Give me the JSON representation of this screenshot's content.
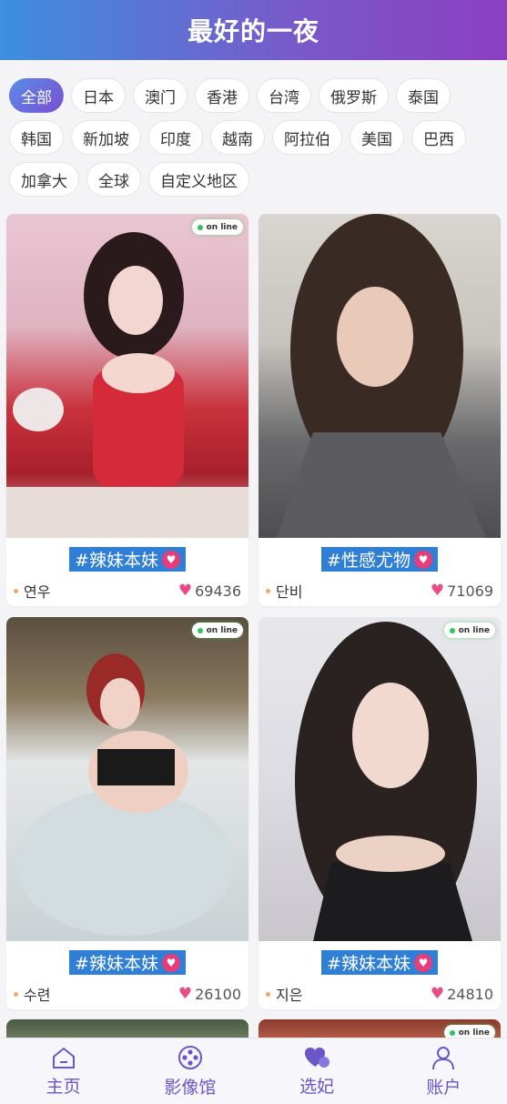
{
  "header": {
    "title": "最好的一夜"
  },
  "regions": {
    "items": [
      "全部",
      "日本",
      "澳门",
      "香港",
      "台湾",
      "俄罗斯",
      "泰国",
      "韩国",
      "新加坡",
      "印度",
      "越南",
      "阿拉伯",
      "美国",
      "巴西",
      "加拿大",
      "全球",
      "自定义地区"
    ],
    "active": "全部"
  },
  "online_label": "on line",
  "cards": [
    {
      "tag": "#辣妹本妹",
      "name": "연우",
      "likes": "69436"
    },
    {
      "tag": "#性感尤物",
      "name": "단비",
      "likes": "71069"
    },
    {
      "tag": "#辣妹本妹",
      "name": "수련",
      "likes": "26100"
    },
    {
      "tag": "#辣妹本妹",
      "name": "지은",
      "likes": "24810"
    }
  ],
  "tabbar": {
    "home": "主页",
    "cinema": "影像馆",
    "select": "选妃",
    "account": "账户"
  },
  "colors": {
    "accent": "#6a56c9",
    "tag_bg": "#2f7fd6",
    "heart": "#e84a8a",
    "online": "#30c45c"
  }
}
